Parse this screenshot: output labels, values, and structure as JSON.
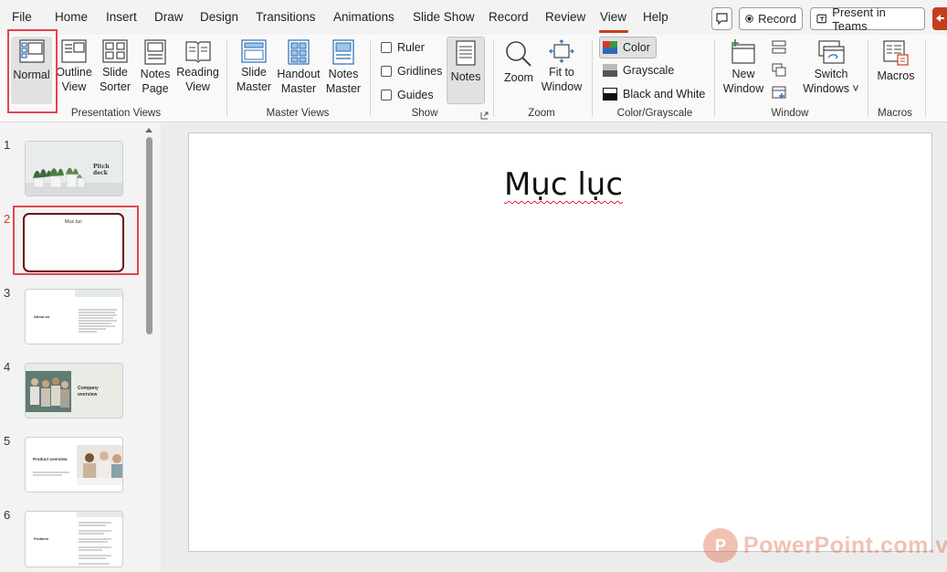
{
  "menu": {
    "tabs": [
      {
        "label": "File"
      },
      {
        "label": "Home"
      },
      {
        "label": "Insert"
      },
      {
        "label": "Draw"
      },
      {
        "label": "Design"
      },
      {
        "label": "Transitions"
      },
      {
        "label": "Animations"
      },
      {
        "label": "Slide Show"
      },
      {
        "label": "Record"
      },
      {
        "label": "Review"
      },
      {
        "label": "View"
      },
      {
        "label": "Help"
      }
    ],
    "active_tab": "View",
    "record_label": "Record",
    "teams_label": "Present in Teams"
  },
  "ribbon": {
    "presentation_views": {
      "label": "Presentation Views",
      "normal": [
        "Normal"
      ],
      "outline": [
        "Outline",
        "View"
      ],
      "sorter": [
        "Slide",
        "Sorter"
      ],
      "notes_page": [
        "Notes",
        "Page"
      ],
      "reading": [
        "Reading",
        "View"
      ]
    },
    "master_views": {
      "label": "Master Views",
      "slide_master": [
        "Slide",
        "Master"
      ],
      "handout_master": [
        "Handout",
        "Master"
      ],
      "notes_master": [
        "Notes",
        "Master"
      ]
    },
    "show": {
      "label": "Show",
      "ruler": "Ruler",
      "gridlines": "Gridlines",
      "guides": "Guides",
      "notes": "Notes"
    },
    "zoom": {
      "label": "Zoom",
      "zoom": "Zoom",
      "fit": [
        "Fit to",
        "Window"
      ]
    },
    "color": {
      "label": "Color/Grayscale",
      "color": "Color",
      "grayscale": "Grayscale",
      "bw": "Black and White"
    },
    "window": {
      "label": "Window",
      "new_window": [
        "New",
        "Window"
      ],
      "switch": [
        "Switch",
        "Windows ˅"
      ]
    },
    "macros": {
      "label": "Macros",
      "macros": "Macros"
    }
  },
  "slides": [
    {
      "number": "1",
      "text": "Pitch deck"
    },
    {
      "number": "2",
      "text": "Mục lục"
    },
    {
      "number": "3",
      "text": "About us"
    },
    {
      "number": "4",
      "text": "Company overview"
    },
    {
      "number": "5",
      "text": "Product overview"
    },
    {
      "number": "6",
      "text": "Problem"
    }
  ],
  "current_slide": {
    "title": "Mục lục"
  },
  "watermark": {
    "logo": "P",
    "text": "PowerPoint.com.vn"
  },
  "colors": {
    "accent": "#c43e1c",
    "highlight_box": "#e0474c",
    "selected_slide_border": "#6b0d12"
  }
}
